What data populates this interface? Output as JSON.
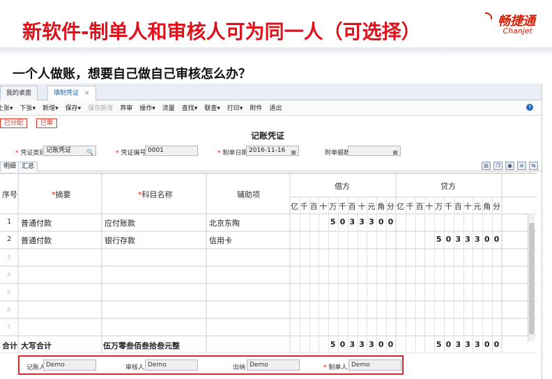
{
  "slide": {
    "title": "新软件-制单人和审核人可为同一人（可选择）",
    "question": "一个人做账，想要自己做自己审核怎么办？",
    "logo_cn": "畅捷通",
    "logo_en": "Chanjet",
    "accent_color": "#e0111b"
  },
  "tabs": [
    {
      "label": "我的桌面"
    },
    {
      "label": "填制凭证",
      "close": "×"
    }
  ],
  "toolbar": [
    "上张",
    "下张",
    "新增",
    "保存",
    "保存新增",
    "弃审",
    "操作",
    "流量",
    "查找",
    "联查",
    "打印",
    "附件",
    "退出"
  ],
  "toolbar_dropdown_marks": [
    "▾"
  ],
  "help_icon": "?",
  "status": {
    "allocated": "已分配",
    "approved": "已审"
  },
  "voucher": {
    "title": "记账凭证",
    "type_label": "凭证类别",
    "type_value": "记账凭证",
    "no_label": "凭证编号",
    "no_value": "0001",
    "date_label": "制单日期",
    "date_value": "2016-11-16",
    "attach_label": "附单据数",
    "attach_value": ""
  },
  "subtabs": [
    "明细",
    "汇总"
  ],
  "grid": {
    "headers": {
      "seq": "序号",
      "summary": "摘要",
      "subject": "科目名称",
      "aux": "辅助项",
      "debit": "借方",
      "credit": "贷方"
    },
    "units": [
      "亿",
      "千",
      "百",
      "十",
      "万",
      "千",
      "百",
      "十",
      "元",
      "角",
      "分"
    ],
    "rows": [
      {
        "seq": "1",
        "summary": "普通付款",
        "subject": "应付账款",
        "aux": "北京东陶",
        "debit": [
          "5",
          "0",
          "3",
          "3",
          "3",
          "0",
          "0"
        ],
        "credit": []
      },
      {
        "seq": "2",
        "summary": "普通付款",
        "subject": "银行存款",
        "aux": "信用卡",
        "debit": [],
        "credit": [
          "5",
          "0",
          "3",
          "3",
          "3",
          "0",
          "0"
        ]
      },
      {
        "seq": "3"
      },
      {
        "seq": "4"
      },
      {
        "seq": "5"
      },
      {
        "seq": "6"
      },
      {
        "seq": "7"
      }
    ],
    "total": {
      "label": "合计",
      "caps_label": "大写合计",
      "caps_value": "伍万零叁佰叁拾叁元整",
      "debit": [
        "5",
        "0",
        "3",
        "3",
        "3",
        "0",
        "0"
      ],
      "credit": [
        "5",
        "0",
        "3",
        "3",
        "3",
        "0",
        "0"
      ]
    }
  },
  "signers": {
    "bookkeeper_label": "记账人",
    "bookkeeper_value": "Demo",
    "auditor_label": "审核人",
    "auditor_value": "Demo",
    "cashier_label": "出纳",
    "cashier_value": "Demo",
    "maker_label": "制单人",
    "maker_value": "Demo"
  },
  "required_mark": "*",
  "search_icon": "🔍",
  "calendar_icon": "▦"
}
